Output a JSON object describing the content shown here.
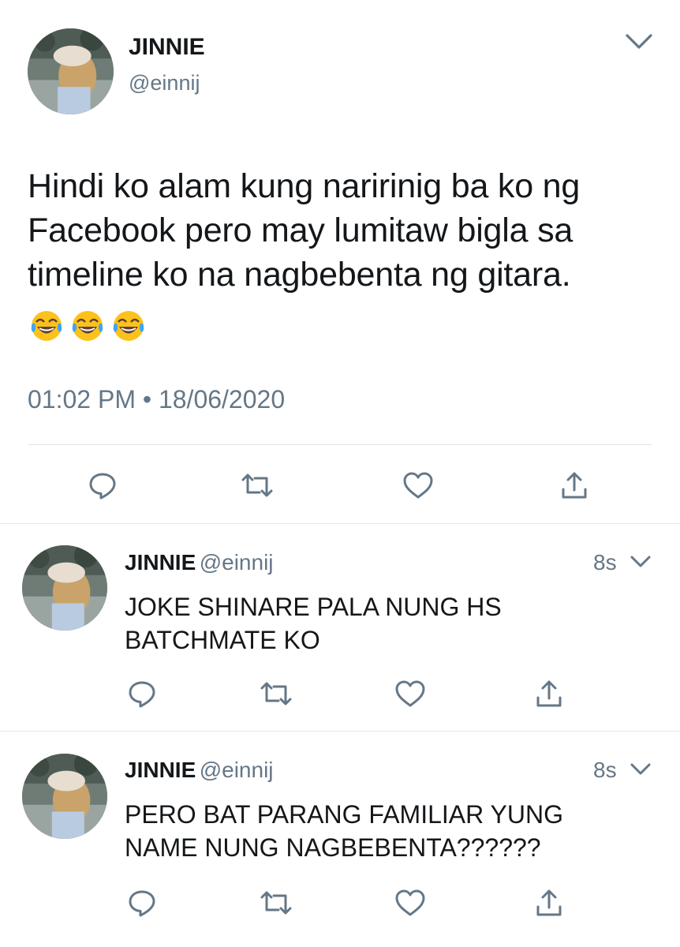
{
  "main_tweet": {
    "name": "JINNIE",
    "handle": "@einnij",
    "text": "Hindi ko alam kung naririnig ba ko ng Facebook pero may lumitaw bigla sa timeline ko na nagbebenta ng gitara.",
    "emoji": [
      "face-with-tears-of-joy",
      "face-with-tears-of-joy",
      "face-with-tears-of-joy"
    ],
    "time": "01:02 PM",
    "separator": "•",
    "date": "18/06/2020"
  },
  "replies": [
    {
      "name": "JINNIE",
      "handle": "@einnij",
      "time": "8s",
      "text": "JOKE SHINARE PALA NUNG HS BATCHMATE KO"
    },
    {
      "name": "JINNIE",
      "handle": "@einnij",
      "time": "8s",
      "text": "PERO BAT PARANG FAMILIAR YUNG NAME NUNG NAGBEBENTA??????"
    }
  ],
  "colors": {
    "text_primary": "#14171a",
    "text_secondary": "#657786",
    "icon": "#657786",
    "divider": "#e1e8ed"
  },
  "icons": [
    "chevron-down-icon",
    "reply-icon",
    "retweet-icon",
    "like-icon",
    "share-icon"
  ]
}
